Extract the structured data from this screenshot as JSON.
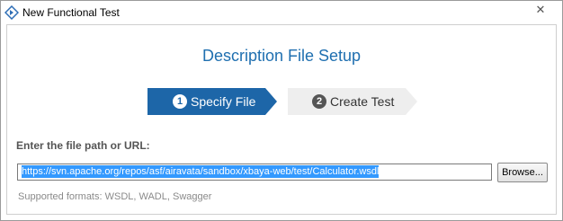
{
  "window": {
    "title": "New Functional Test",
    "close_glyph": "✕",
    "app_icon": "diamond-arrows-icon",
    "close_icon": "close-icon"
  },
  "dialog": {
    "heading": "Description File Setup"
  },
  "steps": [
    {
      "number": "1",
      "label": "Specify File",
      "state": "active",
      "color": "#1d66a8"
    },
    {
      "number": "2",
      "label": "Create Test",
      "state": "inactive",
      "color": "#eeeeee"
    }
  ],
  "form": {
    "label": "Enter the file path or URL:",
    "path_value": "https://svn.apache.org/repos/asf/airavata/sandbox/xbaya-web/test/Calculator.wsdl",
    "browse_label": "Browse...",
    "hint": "Supported formats: WSDL, WADL, Swagger"
  },
  "colors": {
    "accent": "#1f6fb0",
    "selection": "#3399ff"
  }
}
